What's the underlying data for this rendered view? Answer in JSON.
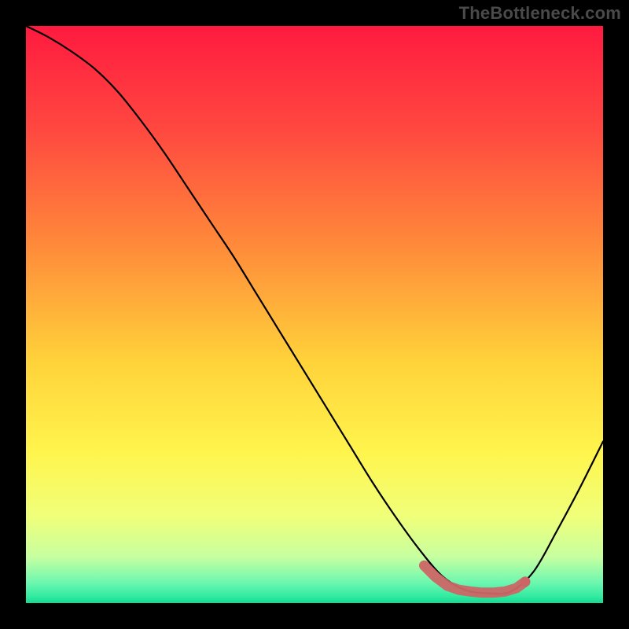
{
  "attribution": "TheBottleneck.com",
  "chart_data": {
    "type": "line",
    "title": "",
    "xlabel": "",
    "ylabel": "",
    "xlim": [
      0,
      100
    ],
    "ylim": [
      0,
      100
    ],
    "grid": false,
    "series": [
      {
        "name": "curve",
        "color": "#000000",
        "x": [
          0,
          4,
          8,
          12,
          16,
          20,
          24,
          28,
          32,
          36,
          40,
          44,
          48,
          52,
          56,
          60,
          64,
          68,
          72,
          76,
          80,
          84,
          88,
          92,
          96,
          100
        ],
        "values": [
          100,
          98,
          95.5,
          92.5,
          88.5,
          83.5,
          78,
          72,
          66,
          60,
          53.5,
          47,
          40.5,
          34,
          27.5,
          21,
          15,
          9.5,
          4.8,
          2.3,
          1.7,
          2.0,
          5.5,
          12.5,
          20,
          28
        ]
      },
      {
        "name": "flat-highlight",
        "color": "#cc6666",
        "x": [
          69,
          71,
          73,
          75,
          77,
          79,
          81,
          83,
          85,
          86.5
        ],
        "values": [
          6.5,
          4.5,
          3.0,
          2.3,
          2.0,
          1.8,
          1.8,
          2.0,
          2.6,
          3.7
        ]
      }
    ],
    "background_gradient": {
      "stops": [
        {
          "offset": 0.0,
          "color": "#ff1a3f"
        },
        {
          "offset": 0.18,
          "color": "#ff4840"
        },
        {
          "offset": 0.38,
          "color": "#ff8a3a"
        },
        {
          "offset": 0.58,
          "color": "#ffd23a"
        },
        {
          "offset": 0.74,
          "color": "#fff54d"
        },
        {
          "offset": 0.85,
          "color": "#f0ff7a"
        },
        {
          "offset": 0.92,
          "color": "#c7ffa0"
        },
        {
          "offset": 0.965,
          "color": "#6cf7b0"
        },
        {
          "offset": 0.99,
          "color": "#2ee9a0"
        },
        {
          "offset": 1.0,
          "color": "#15d890"
        }
      ]
    }
  }
}
